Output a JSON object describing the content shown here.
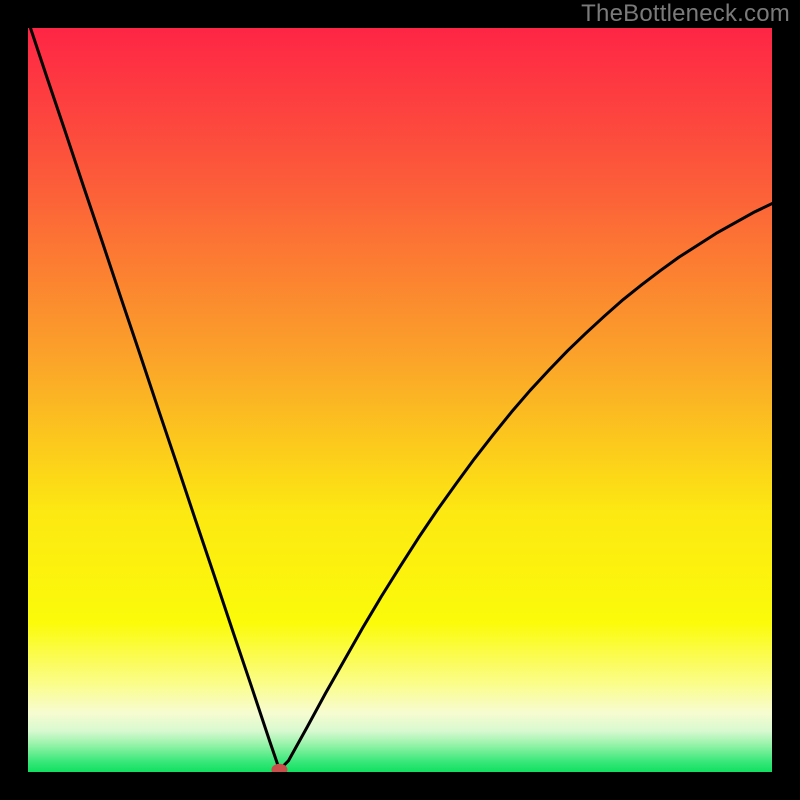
{
  "watermark": "TheBottleneck.com",
  "chart_data": {
    "type": "line",
    "title": "",
    "xlabel": "",
    "ylabel": "",
    "xlim": [
      0,
      1
    ],
    "ylim": [
      0,
      1
    ],
    "x": [
      0.0,
      0.025,
      0.05,
      0.075,
      0.1,
      0.125,
      0.15,
      0.175,
      0.2,
      0.225,
      0.25,
      0.275,
      0.3,
      0.325,
      0.338,
      0.35,
      0.375,
      0.4,
      0.425,
      0.45,
      0.475,
      0.5,
      0.525,
      0.55,
      0.575,
      0.6,
      0.625,
      0.65,
      0.675,
      0.7,
      0.725,
      0.75,
      0.775,
      0.8,
      0.825,
      0.85,
      0.875,
      0.9,
      0.925,
      0.95,
      0.975,
      1.0
    ],
    "values": [
      1.01,
      0.935,
      0.861,
      0.786,
      0.712,
      0.637,
      0.563,
      0.488,
      0.414,
      0.339,
      0.265,
      0.19,
      0.116,
      0.041,
      0.003,
      0.015,
      0.06,
      0.106,
      0.15,
      0.194,
      0.236,
      0.276,
      0.315,
      0.352,
      0.387,
      0.421,
      0.453,
      0.484,
      0.513,
      0.54,
      0.566,
      0.59,
      0.613,
      0.635,
      0.655,
      0.674,
      0.692,
      0.708,
      0.724,
      0.738,
      0.752,
      0.764
    ],
    "marker": {
      "x": 0.338,
      "y": 0.003,
      "color": "#c94f4a"
    },
    "background_gradient": {
      "stops": [
        {
          "offset": 0.0,
          "color": "#fe2545"
        },
        {
          "offset": 0.2,
          "color": "#fc5a3a"
        },
        {
          "offset": 0.45,
          "color": "#fba529"
        },
        {
          "offset": 0.65,
          "color": "#fce812"
        },
        {
          "offset": 0.8,
          "color": "#fbfb0a"
        },
        {
          "offset": 0.88,
          "color": "#fbfd87"
        },
        {
          "offset": 0.92,
          "color": "#f7fcd0"
        },
        {
          "offset": 0.945,
          "color": "#d8f9d0"
        },
        {
          "offset": 0.965,
          "color": "#8ff2a5"
        },
        {
          "offset": 0.985,
          "color": "#3de87c"
        },
        {
          "offset": 1.0,
          "color": "#0fe060"
        }
      ]
    },
    "line_color": "#000000",
    "line_width": 3
  }
}
